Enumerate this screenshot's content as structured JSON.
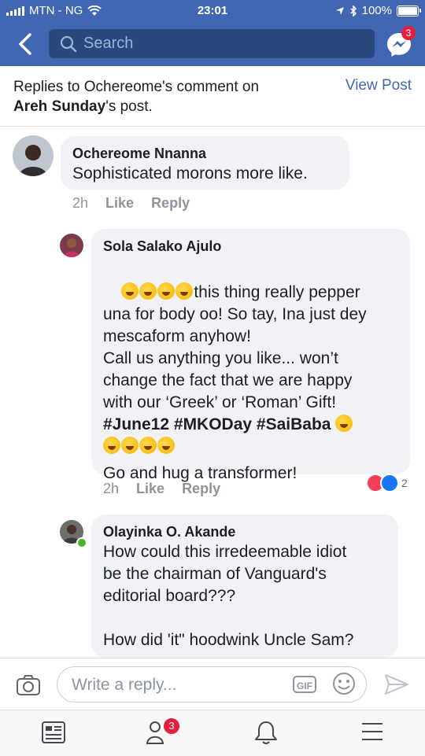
{
  "status": {
    "carrier": "MTN - NG",
    "time": "23:01",
    "battery": "100%"
  },
  "header": {
    "search_placeholder": "Search",
    "messenger_badge": "3"
  },
  "context": {
    "prefix": "Replies to ",
    "author": "Ochereome's",
    "mid": " comment on ",
    "post_owner": "Areh Sunday",
    "suffix": "'s post.",
    "view_post": "View Post"
  },
  "comments": [
    {
      "name": "Ochereome Nnanna",
      "text": "Sophisticated morons more like.",
      "time": "2h",
      "like": "Like",
      "reply": "Reply"
    },
    {
      "name": "Sola Salako Ajulo",
      "line1": "this thing really pepper",
      "body": "una for body oo! So tay, Ina just dey\nmescaform anyhow!\nCall us anything you like... won’t\nchange the fact that we are happy\nwith our ‘Greek’ or ‘Roman’ Gift!",
      "tags": "#June12 #MKODay #SaiBaba",
      "last": "Go and hug a transformer!",
      "time": "2h",
      "like": "Like",
      "reply": "Reply",
      "reaction_count": "2"
    },
    {
      "name": "Olayinka O. Akande",
      "text": "How could this irredeemable idiot\nbe the chairman of Vanguard's\neditorial board???\n\nHow did 'it\" hoodwink Uncle Sam?"
    }
  ],
  "compose": {
    "placeholder": "Write a reply...",
    "gif": "GIF"
  },
  "tabs": {
    "friends_badge": "3"
  },
  "colors": {
    "brand": "#4267b2",
    "link": "#4267b2",
    "badge": "#e41e3f"
  }
}
